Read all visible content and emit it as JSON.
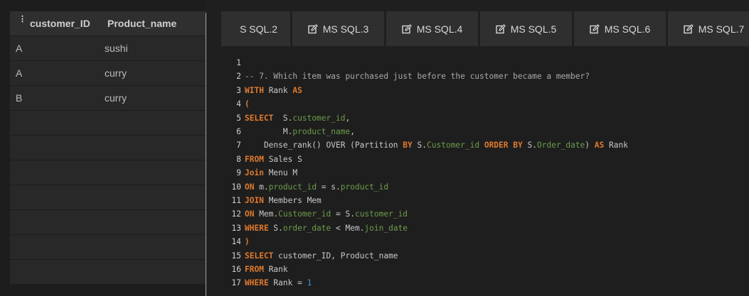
{
  "results": {
    "columns": [
      "customer_ID",
      "Product_name"
    ],
    "rows": [
      [
        "A",
        "sushi"
      ],
      [
        "A",
        "curry"
      ],
      [
        "B",
        "curry"
      ]
    ],
    "empty_rows": 7
  },
  "tabs": [
    {
      "label": "S SQL.2",
      "icon": "edit-icon",
      "partial": true
    },
    {
      "label": "MS SQL.3",
      "icon": "edit-icon"
    },
    {
      "label": "MS SQL.4",
      "icon": "edit-icon"
    },
    {
      "label": "MS SQL.5",
      "icon": "edit-icon"
    },
    {
      "label": "MS SQL.6",
      "icon": "edit-icon"
    },
    {
      "label": "MS SQL.7",
      "icon": "edit-icon"
    }
  ],
  "editor": {
    "lines": [
      [],
      [
        {
          "t": "-- 7. Which item was purchased just before the customer became a member?",
          "c": "cm"
        }
      ],
      [
        {
          "t": "WITH",
          "c": "kw"
        },
        {
          "t": " Rank "
        },
        {
          "t": "AS",
          "c": "kw"
        }
      ],
      [
        {
          "t": "(",
          "c": "kw"
        }
      ],
      [
        {
          "t": "SELECT",
          "c": "kw"
        },
        {
          "t": "  S."
        },
        {
          "t": "customer_id",
          "c": "fld"
        },
        {
          "t": ","
        }
      ],
      [
        {
          "t": "        M."
        },
        {
          "t": "product_name",
          "c": "fld"
        },
        {
          "t": ","
        }
      ],
      [
        {
          "t": "    Dense_rank() OVER (Partition "
        },
        {
          "t": "BY",
          "c": "kw"
        },
        {
          "t": " S."
        },
        {
          "t": "Customer_id",
          "c": "fld"
        },
        {
          "t": " "
        },
        {
          "t": "ORDER BY",
          "c": "kw"
        },
        {
          "t": " S."
        },
        {
          "t": "Order_date",
          "c": "fld"
        },
        {
          "t": ") "
        },
        {
          "t": "AS",
          "c": "kw"
        },
        {
          "t": " Rank"
        }
      ],
      [
        {
          "t": "FROM",
          "c": "kw"
        },
        {
          "t": " Sales S"
        }
      ],
      [
        {
          "t": "Join",
          "c": "kw"
        },
        {
          "t": " Menu M"
        }
      ],
      [
        {
          "t": "ON",
          "c": "kw"
        },
        {
          "t": " m."
        },
        {
          "t": "product_id",
          "c": "fld"
        },
        {
          "t": " = s."
        },
        {
          "t": "product_id",
          "c": "fld"
        }
      ],
      [
        {
          "t": "JOIN",
          "c": "kw"
        },
        {
          "t": " Members Mem"
        }
      ],
      [
        {
          "t": "ON",
          "c": "kw"
        },
        {
          "t": " Mem."
        },
        {
          "t": "Customer_id",
          "c": "fld"
        },
        {
          "t": " = S."
        },
        {
          "t": "customer_id",
          "c": "fld"
        }
      ],
      [
        {
          "t": "WHERE",
          "c": "kw"
        },
        {
          "t": " S."
        },
        {
          "t": "order_date",
          "c": "fld"
        },
        {
          "t": " < Mem."
        },
        {
          "t": "join_date",
          "c": "fld"
        }
      ],
      [
        {
          "t": ")",
          "c": "kw"
        }
      ],
      [
        {
          "t": "SELECT",
          "c": "kw"
        },
        {
          "t": " customer_ID, Product_name"
        }
      ],
      [
        {
          "t": "FROM",
          "c": "kw"
        },
        {
          "t": " Rank"
        }
      ],
      [
        {
          "t": "WHERE",
          "c": "kw"
        },
        {
          "t": " Rank = "
        },
        {
          "t": "1",
          "c": "num"
        }
      ]
    ]
  },
  "colors": {
    "keyword": "#e07a2e",
    "field": "#6c9c4a",
    "comment": "#a8a8a8",
    "number": "#3d8fd8",
    "background": "#1f1f1f"
  }
}
